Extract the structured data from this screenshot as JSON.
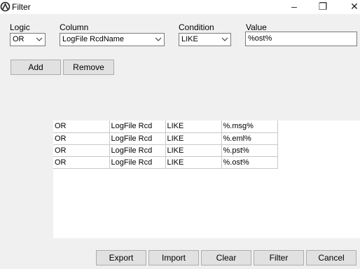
{
  "window": {
    "title": "Filter"
  },
  "form": {
    "logic_label": "Logic",
    "logic_value": "OR",
    "column_label": "Column",
    "column_value": "LogFile RcdName",
    "condition_label": "Condition",
    "condition_value": "LIKE",
    "value_label": "Value",
    "value_text": "%ost%"
  },
  "buttons": {
    "add": "Add",
    "remove": "Remove",
    "export": "Export",
    "import": "Import",
    "clear": "Clear",
    "filter": "Filter",
    "cancel": "Cancel"
  },
  "rows": [
    [
      "OR",
      "LogFile Rcd",
      "LIKE",
      "%.msg%"
    ],
    [
      "OR",
      "LogFile Rcd",
      "LIKE",
      "%.eml%"
    ],
    [
      "OR",
      "LogFile Rcd",
      "LIKE",
      "%.pst%"
    ],
    [
      "OR",
      "LogFile Rcd",
      "LIKE",
      "%.ost%"
    ]
  ]
}
